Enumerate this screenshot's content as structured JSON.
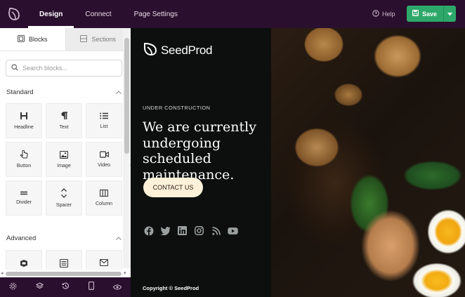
{
  "topbar": {
    "logo_icon": "seedprod-leaf-icon",
    "tabs": [
      {
        "label": "Design",
        "active": true
      },
      {
        "label": "Connect",
        "active": false
      },
      {
        "label": "Page Settings",
        "active": false
      }
    ],
    "help_label": "Help",
    "save_label": "Save",
    "save_color": "#2da86a",
    "bar_color": "#2b0f2e"
  },
  "sidebar": {
    "tabs": [
      {
        "label": "Blocks",
        "icon": "blocks-icon",
        "active": true
      },
      {
        "label": "Sections",
        "icon": "sections-icon",
        "active": false
      }
    ],
    "search_placeholder": "Search blocks...",
    "standard": {
      "title": "Standard",
      "blocks": [
        {
          "label": "Headline",
          "icon": "heading-icon"
        },
        {
          "label": "Text",
          "icon": "paragraph-icon"
        },
        {
          "label": "List",
          "icon": "list-icon"
        },
        {
          "label": "Button",
          "icon": "pointer-icon"
        },
        {
          "label": "Image",
          "icon": "image-icon"
        },
        {
          "label": "Video",
          "icon": "video-icon"
        },
        {
          "label": "Divider",
          "icon": "divider-icon"
        },
        {
          "label": "Spacer",
          "icon": "spacer-icon"
        },
        {
          "label": "Column",
          "icon": "column-icon"
        }
      ]
    },
    "advanced": {
      "title": "Advanced",
      "blocks": [
        {
          "label": "",
          "icon": "optin-icon"
        },
        {
          "label": "",
          "icon": "form-icon"
        },
        {
          "label": "",
          "icon": "mail-icon"
        }
      ]
    },
    "bottom_icons": [
      "settings-icon",
      "layers-icon",
      "history-icon",
      "mobile-preview-icon",
      "preview-eye-icon"
    ]
  },
  "canvas": {
    "brand_name": "SeedProd",
    "eyebrow": "UNDER CONSTRUCTION",
    "headline_lines": [
      "We are currently",
      "undergoing scheduled",
      "maintenance."
    ],
    "cta_label": "CONTACT US",
    "social_icons": [
      "facebook-icon",
      "twitter-icon",
      "linkedin-icon",
      "instagram-icon",
      "rss-icon",
      "youtube-icon"
    ],
    "copyright": "Copyright © SeedProd",
    "background_color": "#0c0f0e",
    "cta_color": "#fdf1d9"
  }
}
